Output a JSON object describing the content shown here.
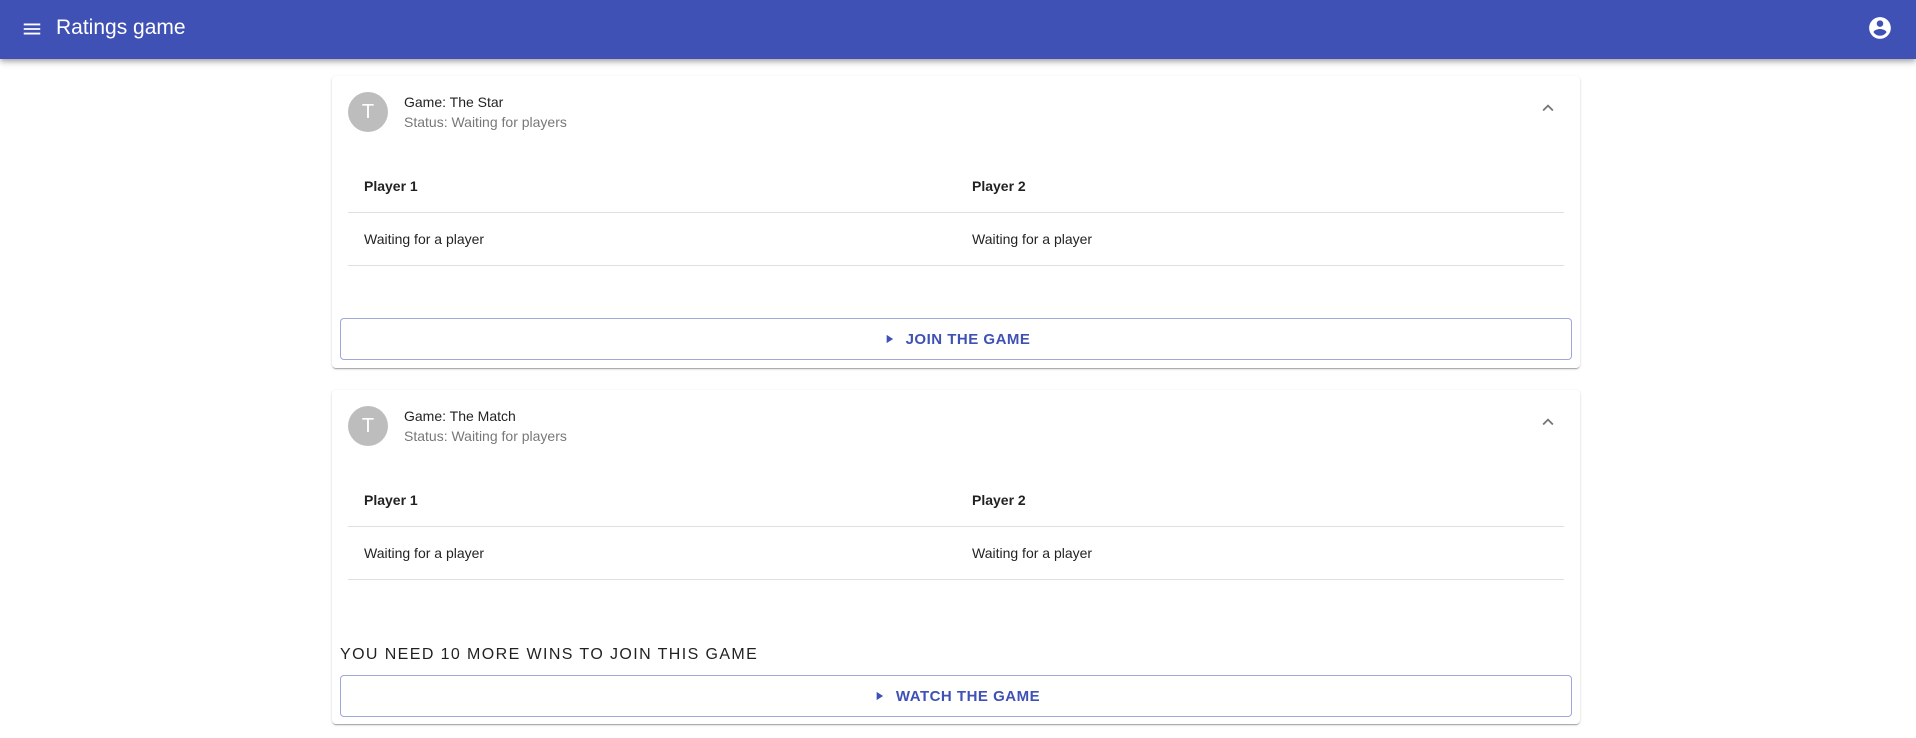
{
  "app": {
    "title": "Ratings game",
    "menu_icon": "menu-icon",
    "account_icon": "account-circle-icon",
    "primary_color": "#3f51b5"
  },
  "games": [
    {
      "avatar_letter": "T",
      "title": "Game: The Star",
      "status": "Status: Waiting for players",
      "columns": [
        "Player 1",
        "Player 2"
      ],
      "players": [
        "Waiting for a player",
        "Waiting for a player"
      ],
      "action_label": "JOIN THE GAME",
      "action_icon": "play-icon",
      "expand_icon": "chevron-up-icon"
    },
    {
      "avatar_letter": "T",
      "title": "Game: The Match",
      "status": "Status: Waiting for players",
      "columns": [
        "Player 1",
        "Player 2"
      ],
      "players": [
        "Waiting for a player",
        "Waiting for a player"
      ],
      "requirement": "YOU NEED 10 MORE WINS TO JOIN THIS GAME",
      "action_label": "WATCH THE GAME",
      "action_icon": "play-icon",
      "expand_icon": "chevron-up-icon"
    }
  ]
}
